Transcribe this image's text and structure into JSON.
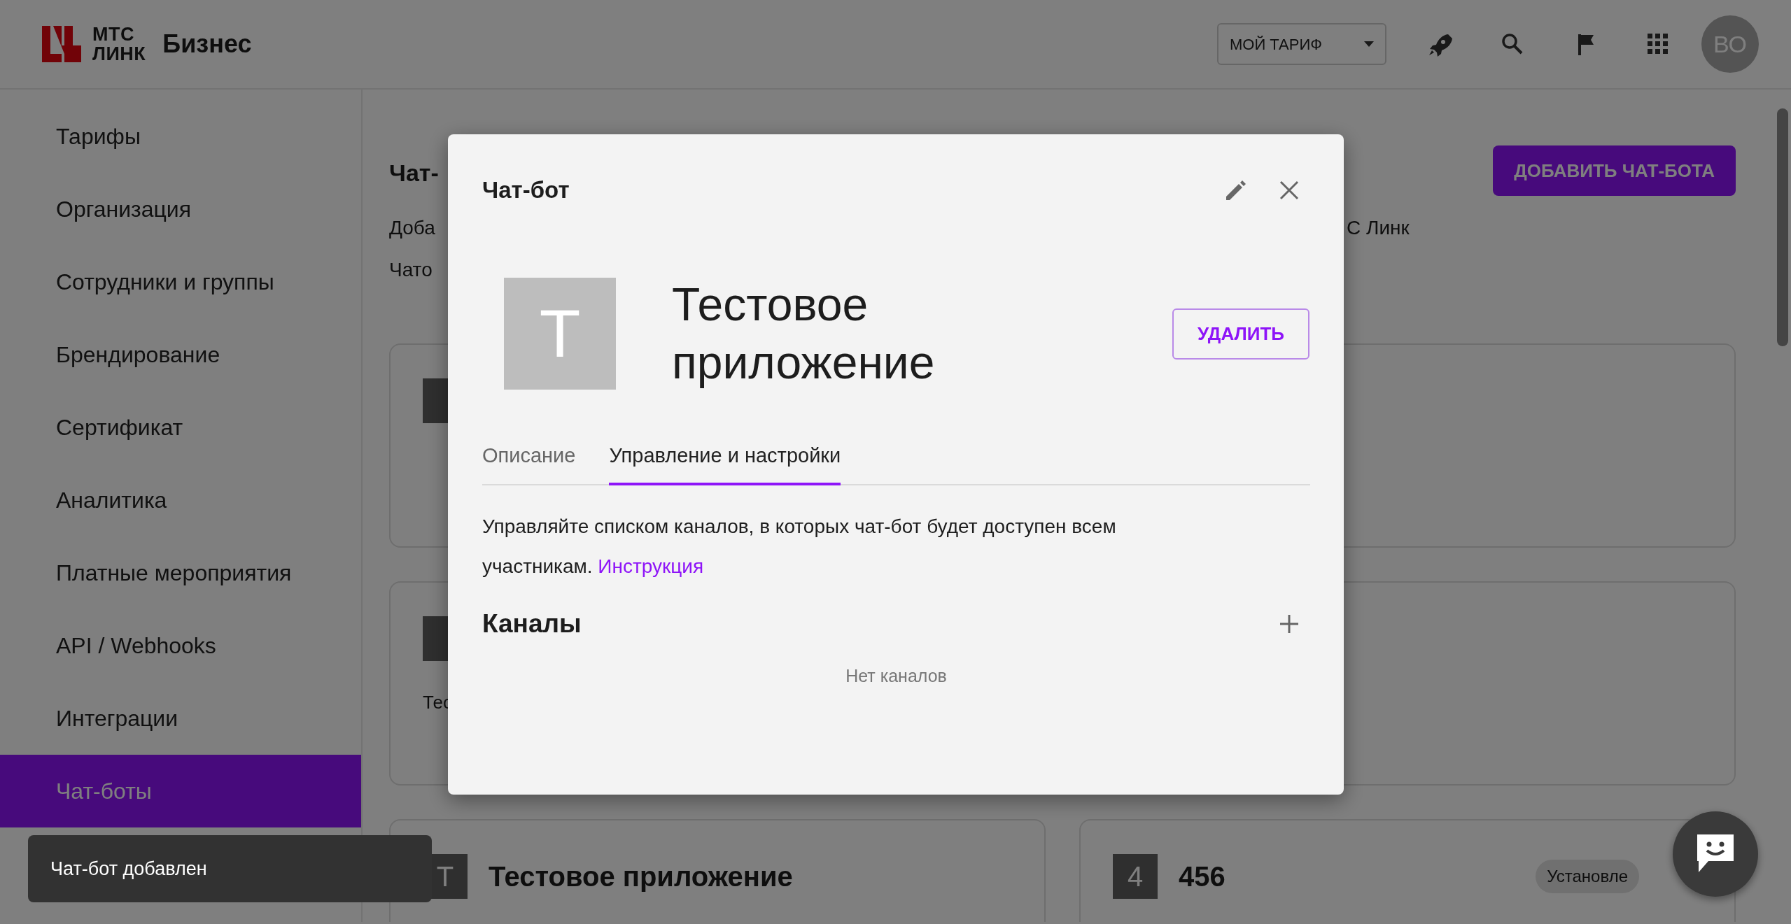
{
  "header": {
    "logo_lines": [
      "МТС",
      "ЛИНК"
    ],
    "product": "Бизнес",
    "tariff_button": "МОЙ ТАРИФ",
    "avatar": "ВО"
  },
  "sidebar": {
    "items": [
      {
        "label": "Тарифы",
        "selected": false
      },
      {
        "label": "Организация",
        "selected": false
      },
      {
        "label": "Сотрудники и группы",
        "selected": false
      },
      {
        "label": "Брендирование",
        "selected": false
      },
      {
        "label": "Сертификат",
        "selected": false
      },
      {
        "label": "Аналитика",
        "selected": false
      },
      {
        "label": "Платные мероприятия",
        "selected": false
      },
      {
        "label": "API / Webhooks",
        "selected": false
      },
      {
        "label": "Интеграции",
        "selected": false
      },
      {
        "label": "Чат-боты",
        "selected": true
      }
    ]
  },
  "page": {
    "title": "Чат-",
    "description_lines": [
      "Доба",
      "Чато"
    ],
    "description_tail": "С Линк",
    "add_button": "ДОБАВИТЬ ЧАТ-БОТА"
  },
  "cards": [
    {
      "kind": "covered"
    },
    {
      "kind": "blank"
    },
    {
      "kind": "covered",
      "text": "Тес"
    },
    {
      "kind": "blank"
    },
    {
      "kind": "bot",
      "avatar": "Т",
      "title": "Тестовое приложение"
    },
    {
      "kind": "bot",
      "avatar": "4",
      "title": "456",
      "badge": "Установле"
    }
  ],
  "modal": {
    "title": "Чат-бот",
    "avatar": "T",
    "name": "Тестовое приложение",
    "delete_button": "УДАЛИТЬ",
    "tabs": [
      {
        "label": "Описание",
        "selected": false
      },
      {
        "label": "Управление и настройки",
        "selected": true
      }
    ],
    "description": "Управляйте списком каналов, в которых чат-бот будет доступен всем участникам.",
    "link": "Инструкция",
    "channels_title": "Каналы",
    "empty_text": "Нет каналов"
  },
  "toast": "Чат-бот добавлен"
}
